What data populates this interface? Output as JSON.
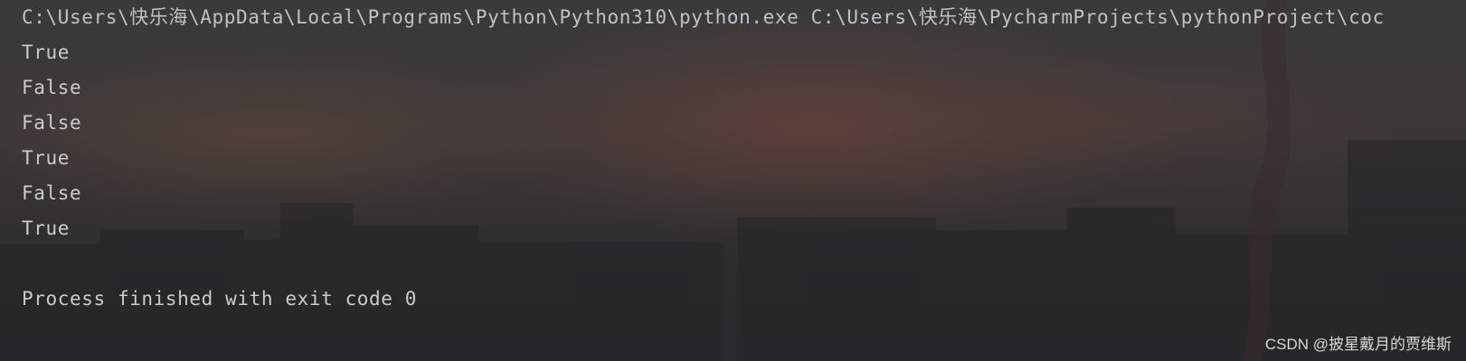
{
  "console": {
    "command": "C:\\Users\\快乐海\\AppData\\Local\\Programs\\Python\\Python310\\python.exe C:\\Users\\快乐海\\PycharmProjects\\pythonProject\\coc",
    "output": [
      "True",
      "False",
      "False",
      "True",
      "False",
      "True"
    ],
    "exit_message": "Process finished with exit code 0"
  },
  "watermark": "CSDN @披星戴月的贾维斯",
  "colors": {
    "text": "#c9cbcd",
    "background": "#2b2b2b"
  }
}
